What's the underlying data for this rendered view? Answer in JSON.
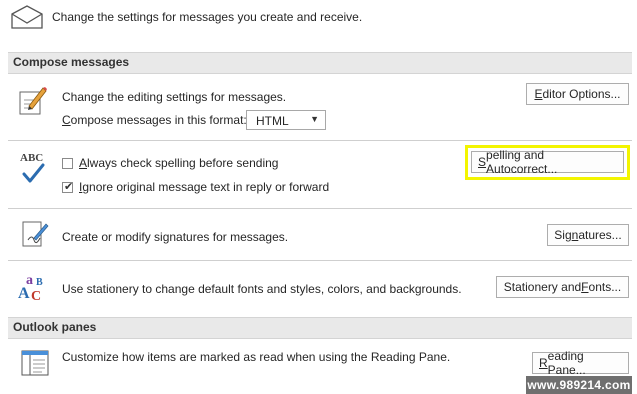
{
  "header": {
    "text": "Change the settings for messages you create and receive."
  },
  "sections": {
    "compose_title": "Compose messages",
    "panes_title": "Outlook panes"
  },
  "editing": {
    "label": "Change the editing settings for messages.",
    "button_acc": "E",
    "button_rest": "ditor Options...",
    "format_acc": "C",
    "format_rest": "ompose messages in this format:",
    "format_value": "HTML"
  },
  "spelling": {
    "abc": "ABC",
    "always_acc": "A",
    "always_rest": "lways check spelling before sending",
    "always_checked": false,
    "ignore_acc": "I",
    "ignore_rest": "gnore original message text in reply or forward",
    "ignore_checked": true,
    "button_acc": "S",
    "button_rest": "pelling and Autocorrect...",
    "highlight_color": "#f3f500"
  },
  "signatures": {
    "label": "Create or modify signatures for messages.",
    "button_pre": "Sig",
    "button_acc": "n",
    "button_post": "atures..."
  },
  "stationery": {
    "label": "Use stationery to change default fonts and styles, colors, and backgrounds.",
    "button_pre": "Stationery and ",
    "button_acc": "F",
    "button_post": "onts..."
  },
  "reading": {
    "label": "Customize how items are marked as read when using the Reading Pane.",
    "button_acc": "R",
    "button_rest": "eading Pane..."
  },
  "watermark": "www.989214.com"
}
